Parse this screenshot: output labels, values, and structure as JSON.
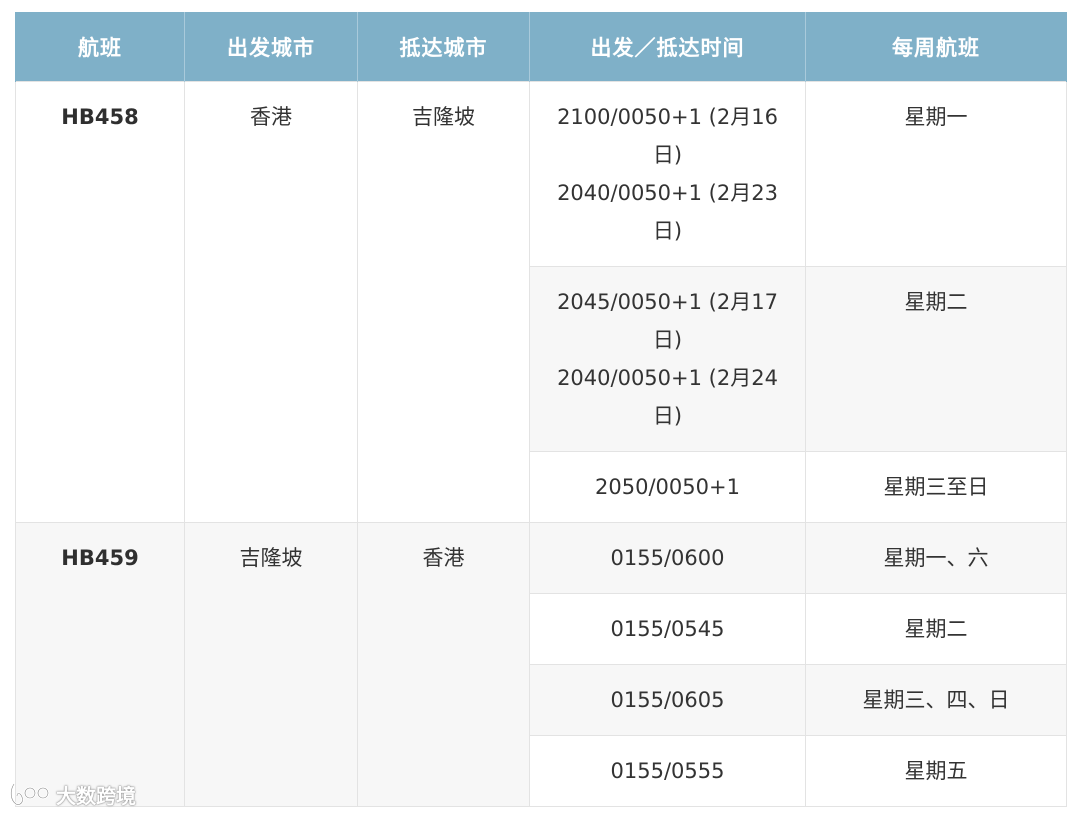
{
  "headers": [
    "航班",
    "出发城市",
    "抵达城市",
    "出发／抵达时间",
    "每周航班"
  ],
  "groups": [
    {
      "flight": "HB458",
      "from": "香港",
      "to": "吉隆坡",
      "rows": [
        {
          "times": [
            "2100/0050+1 (2月16日)",
            "2040/0050+1 (2月23日)"
          ],
          "days": "星期一"
        },
        {
          "times": [
            "2045/0050+1 (2月17日)",
            "2040/0050+1 (2月24日)"
          ],
          "days": "星期二"
        },
        {
          "times": [
            "2050/0050+1"
          ],
          "days": "星期三至日"
        }
      ]
    },
    {
      "flight": "HB459",
      "from": "吉隆坡",
      "to": "香港",
      "rows": [
        {
          "times": [
            "0155/0600"
          ],
          "days": "星期一、六"
        },
        {
          "times": [
            "0155/0545"
          ],
          "days": "星期二"
        },
        {
          "times": [
            "0155/0605"
          ],
          "days": "星期三、四、日"
        },
        {
          "times": [
            "0155/0555"
          ],
          "days": "星期五"
        }
      ]
    }
  ],
  "watermark": {
    "text": "大数跨境",
    "icon": "logo-icon"
  },
  "colors": {
    "header_bg": "#7fb0c8",
    "header_text": "#ffffff",
    "row_alt": "#f7f7f7",
    "border": "#e3e3e3"
  }
}
